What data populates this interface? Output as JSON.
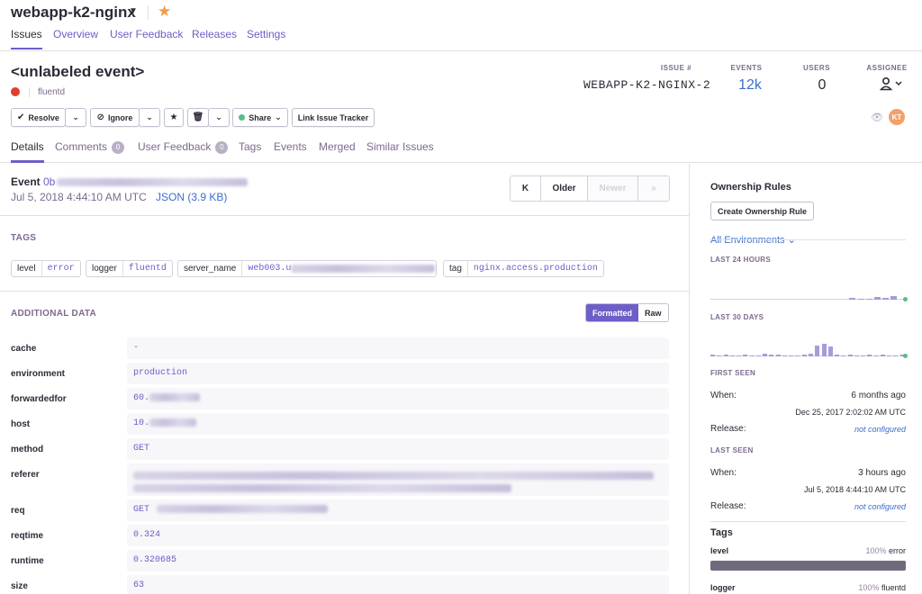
{
  "project": {
    "name": "webapp-k2-nginx"
  },
  "nav": {
    "tabs": [
      "Issues",
      "Overview",
      "User Feedback",
      "Releases",
      "Settings"
    ]
  },
  "issue": {
    "title": "<unlabeled event>",
    "culprit": "fluentd",
    "stats": {
      "issue_label": "ISSUE #",
      "issue_value": "WEBAPP-K2-NGINX-2",
      "events_label": "EVENTS",
      "events_value": "12k",
      "users_label": "USERS",
      "users_value": "0",
      "assignee_label": "ASSIGNEE"
    }
  },
  "actions": {
    "resolve": "Resolve",
    "ignore": "Ignore",
    "share": "Share",
    "link_tracker": "Link Issue Tracker"
  },
  "avatar_initials": "KT",
  "subtabs": {
    "details": "Details",
    "comments": "Comments",
    "comments_count": "0",
    "user_feedback": "User Feedback",
    "user_feedback_count": "0",
    "tags": "Tags",
    "events": "Events",
    "merged": "Merged",
    "similar": "Similar Issues"
  },
  "event": {
    "label": "Event",
    "id_prefix": "0b",
    "date": "Jul 5, 2018 4:44:10 AM UTC",
    "json": "JSON (3.9 KB)",
    "pager": {
      "first": "K",
      "older": "Older",
      "newer": "Newer",
      "last": "»"
    }
  },
  "tags": {
    "title": "TAGS",
    "items": [
      {
        "key": "level",
        "value": "error"
      },
      {
        "key": "logger",
        "value": "fluentd"
      },
      {
        "key": "server_name",
        "value": "web003.u"
      },
      {
        "key": "tag",
        "value": "nginx.access.production"
      }
    ]
  },
  "additional": {
    "title": "ADDITIONAL DATA",
    "formatted": "Formatted",
    "raw": "Raw",
    "rows": [
      {
        "key": "cache",
        "value": "-"
      },
      {
        "key": "environment",
        "value": "production"
      },
      {
        "key": "forwardedfor",
        "value": "60."
      },
      {
        "key": "host",
        "value": "10."
      },
      {
        "key": "method",
        "value": "GET"
      },
      {
        "key": "referer",
        "value": ""
      },
      {
        "key": "req",
        "value": "GET"
      },
      {
        "key": "reqtime",
        "value": "0.324"
      },
      {
        "key": "runtime",
        "value": "0.320685"
      },
      {
        "key": "size",
        "value": "63"
      }
    ]
  },
  "sidebar": {
    "ownership_title": "Ownership Rules",
    "create_rule": "Create Ownership Rule",
    "environments": "All Environments",
    "last24": "LAST 24 HOURS",
    "last30": "LAST 30 DAYS",
    "first_seen": {
      "title": "FIRST SEEN",
      "when_label": "When:",
      "when_value": "6 months ago",
      "when_date": "Dec 25, 2017 2:02:02 AM UTC",
      "release_label": "Release:",
      "release_value": "not configured"
    },
    "last_seen": {
      "title": "LAST SEEN",
      "when_label": "When:",
      "when_value": "3 hours ago",
      "when_date": "Jul 5, 2018 4:44:10 AM UTC",
      "release_label": "Release:",
      "release_value": "not configured"
    },
    "tags_title": "Tags",
    "tag_level": {
      "key": "level",
      "percent": "100%",
      "value": "error"
    },
    "tag_logger": {
      "key": "logger",
      "percent": "100%",
      "value": "fluentd"
    }
  },
  "colors": {
    "accent": "#6c5fc7",
    "link": "#3b6ecc",
    "error": "#e03e2f",
    "star": "#f2994a"
  }
}
